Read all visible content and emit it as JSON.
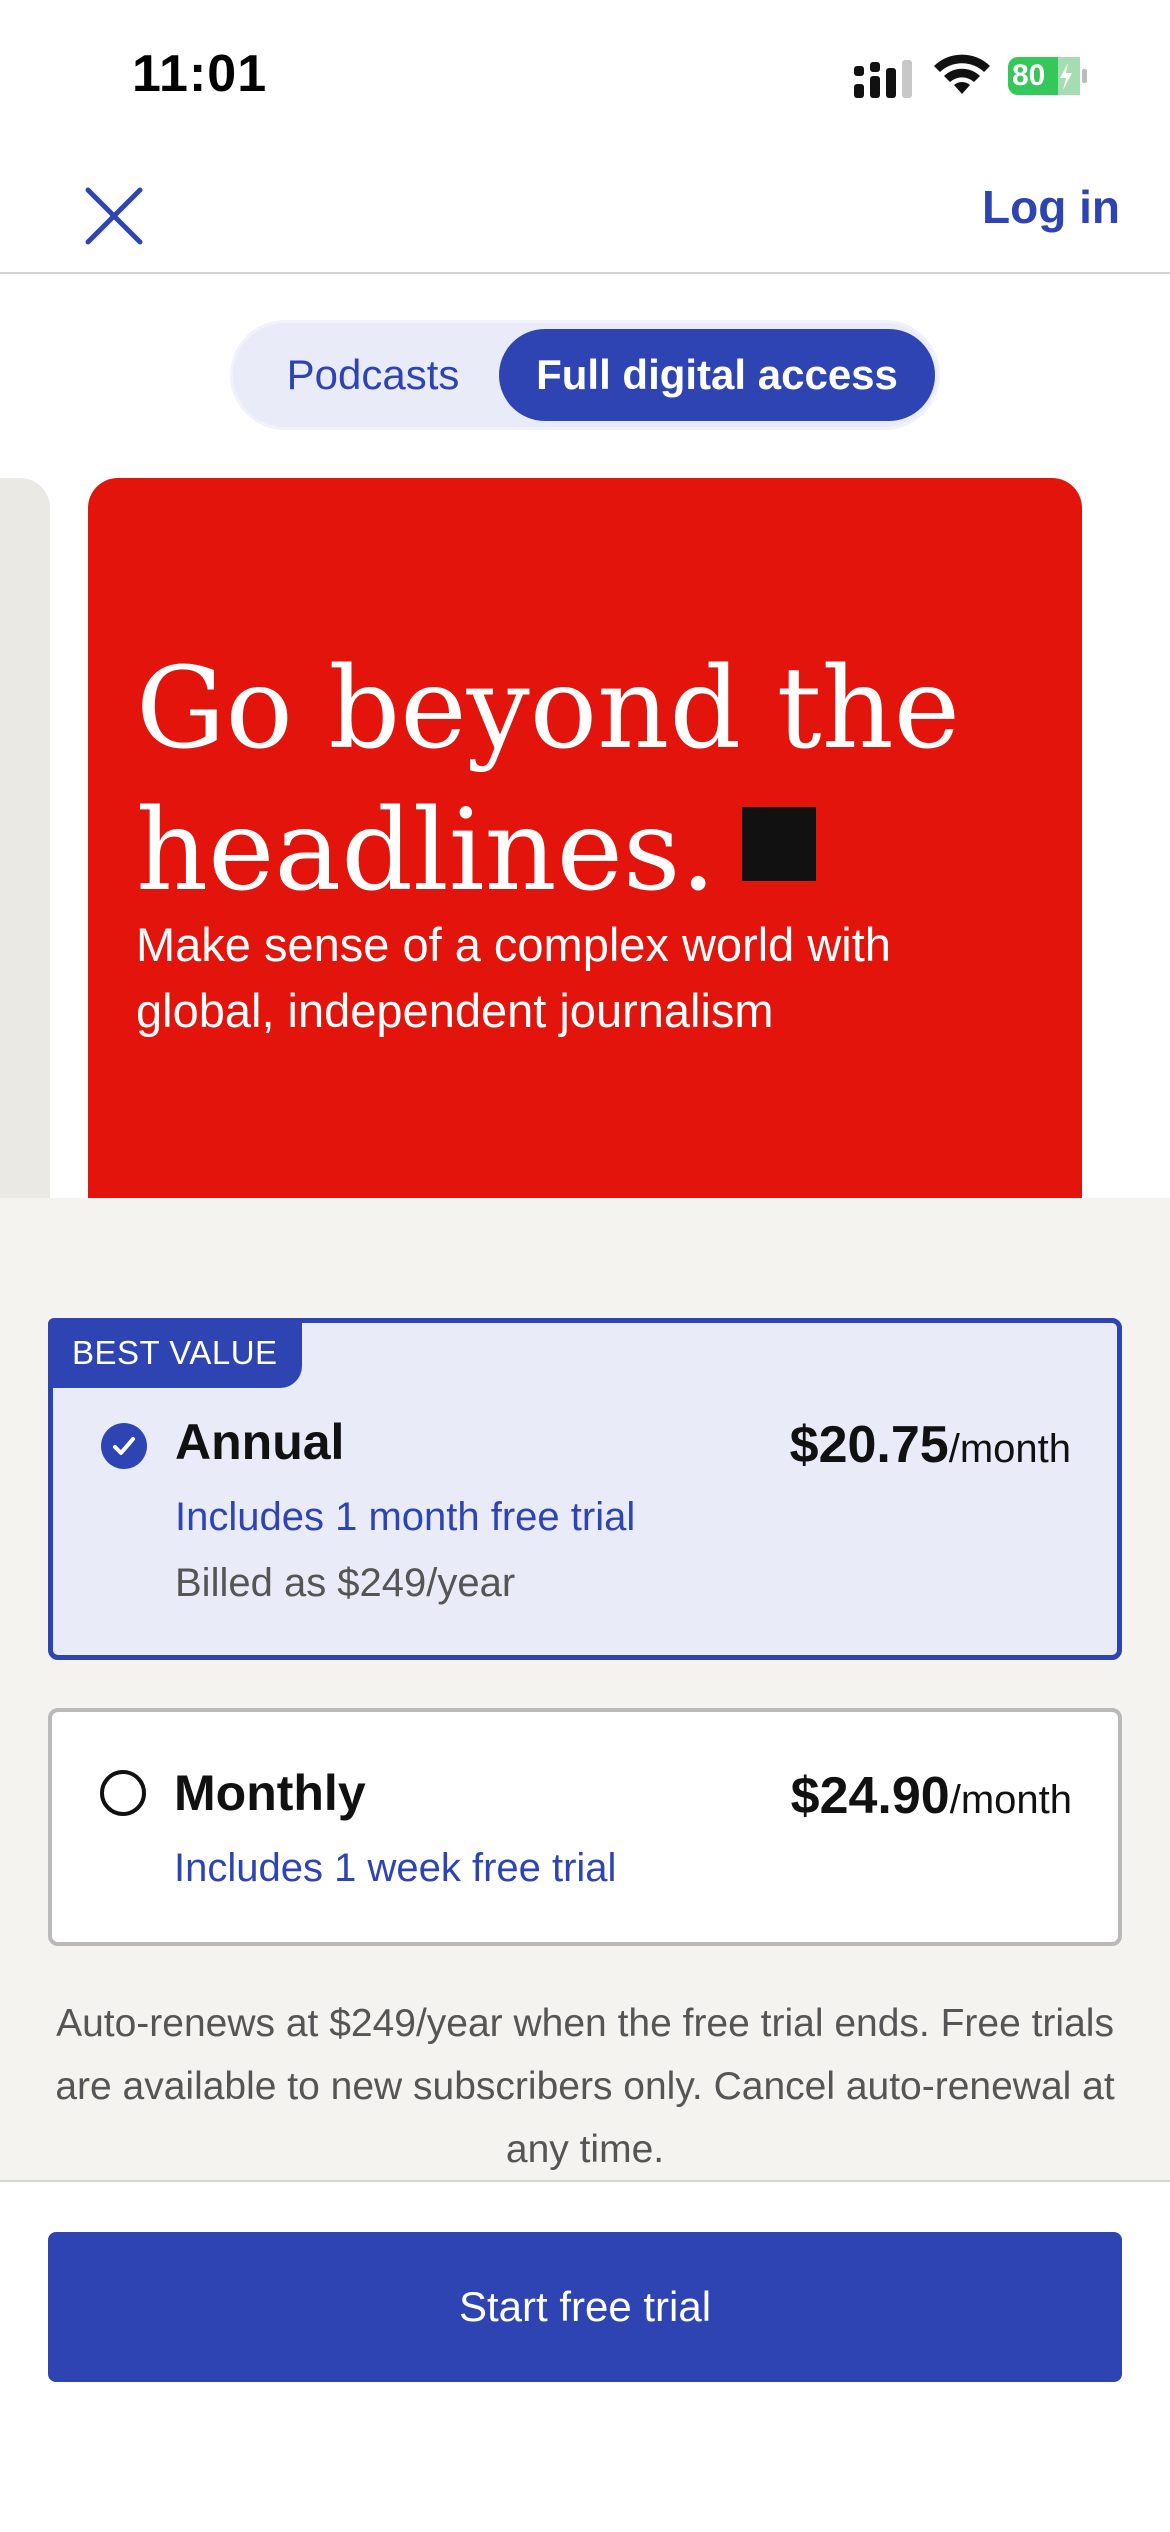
{
  "status_bar": {
    "time": "11:01",
    "battery": "80",
    "icons": [
      "signal-icon",
      "wifi-icon",
      "battery-icon"
    ]
  },
  "header": {
    "close_icon": "close-icon",
    "login_label": "Log in"
  },
  "segmented": {
    "options": [
      {
        "label": "Podcasts",
        "selected": false
      },
      {
        "label": "Full digital access",
        "selected": true
      }
    ]
  },
  "hero": {
    "title_line1": "Go beyond the",
    "title_line2": "headlines.",
    "subtitle": "Make sense of a complex world with global, independent journalism"
  },
  "plans": [
    {
      "badge": "BEST VALUE",
      "name": "Annual",
      "price": "$20.75",
      "per": "/month",
      "trial": "Includes 1 month free trial",
      "billed": "Billed as $249/year",
      "selected": true
    },
    {
      "name": "Monthly",
      "price": "$24.90",
      "per": "/month",
      "trial": "Includes 1 week free trial",
      "selected": false
    }
  ],
  "disclaimer": "Auto-renews at $249/year when the free trial ends. Free trials are available to new subscribers only. Cancel auto-renewal at any time.",
  "cta_label": "Start free trial",
  "colors": {
    "accent": "#2e44b3",
    "hero_red": "#e2140c",
    "battery_green": "#34c759"
  }
}
